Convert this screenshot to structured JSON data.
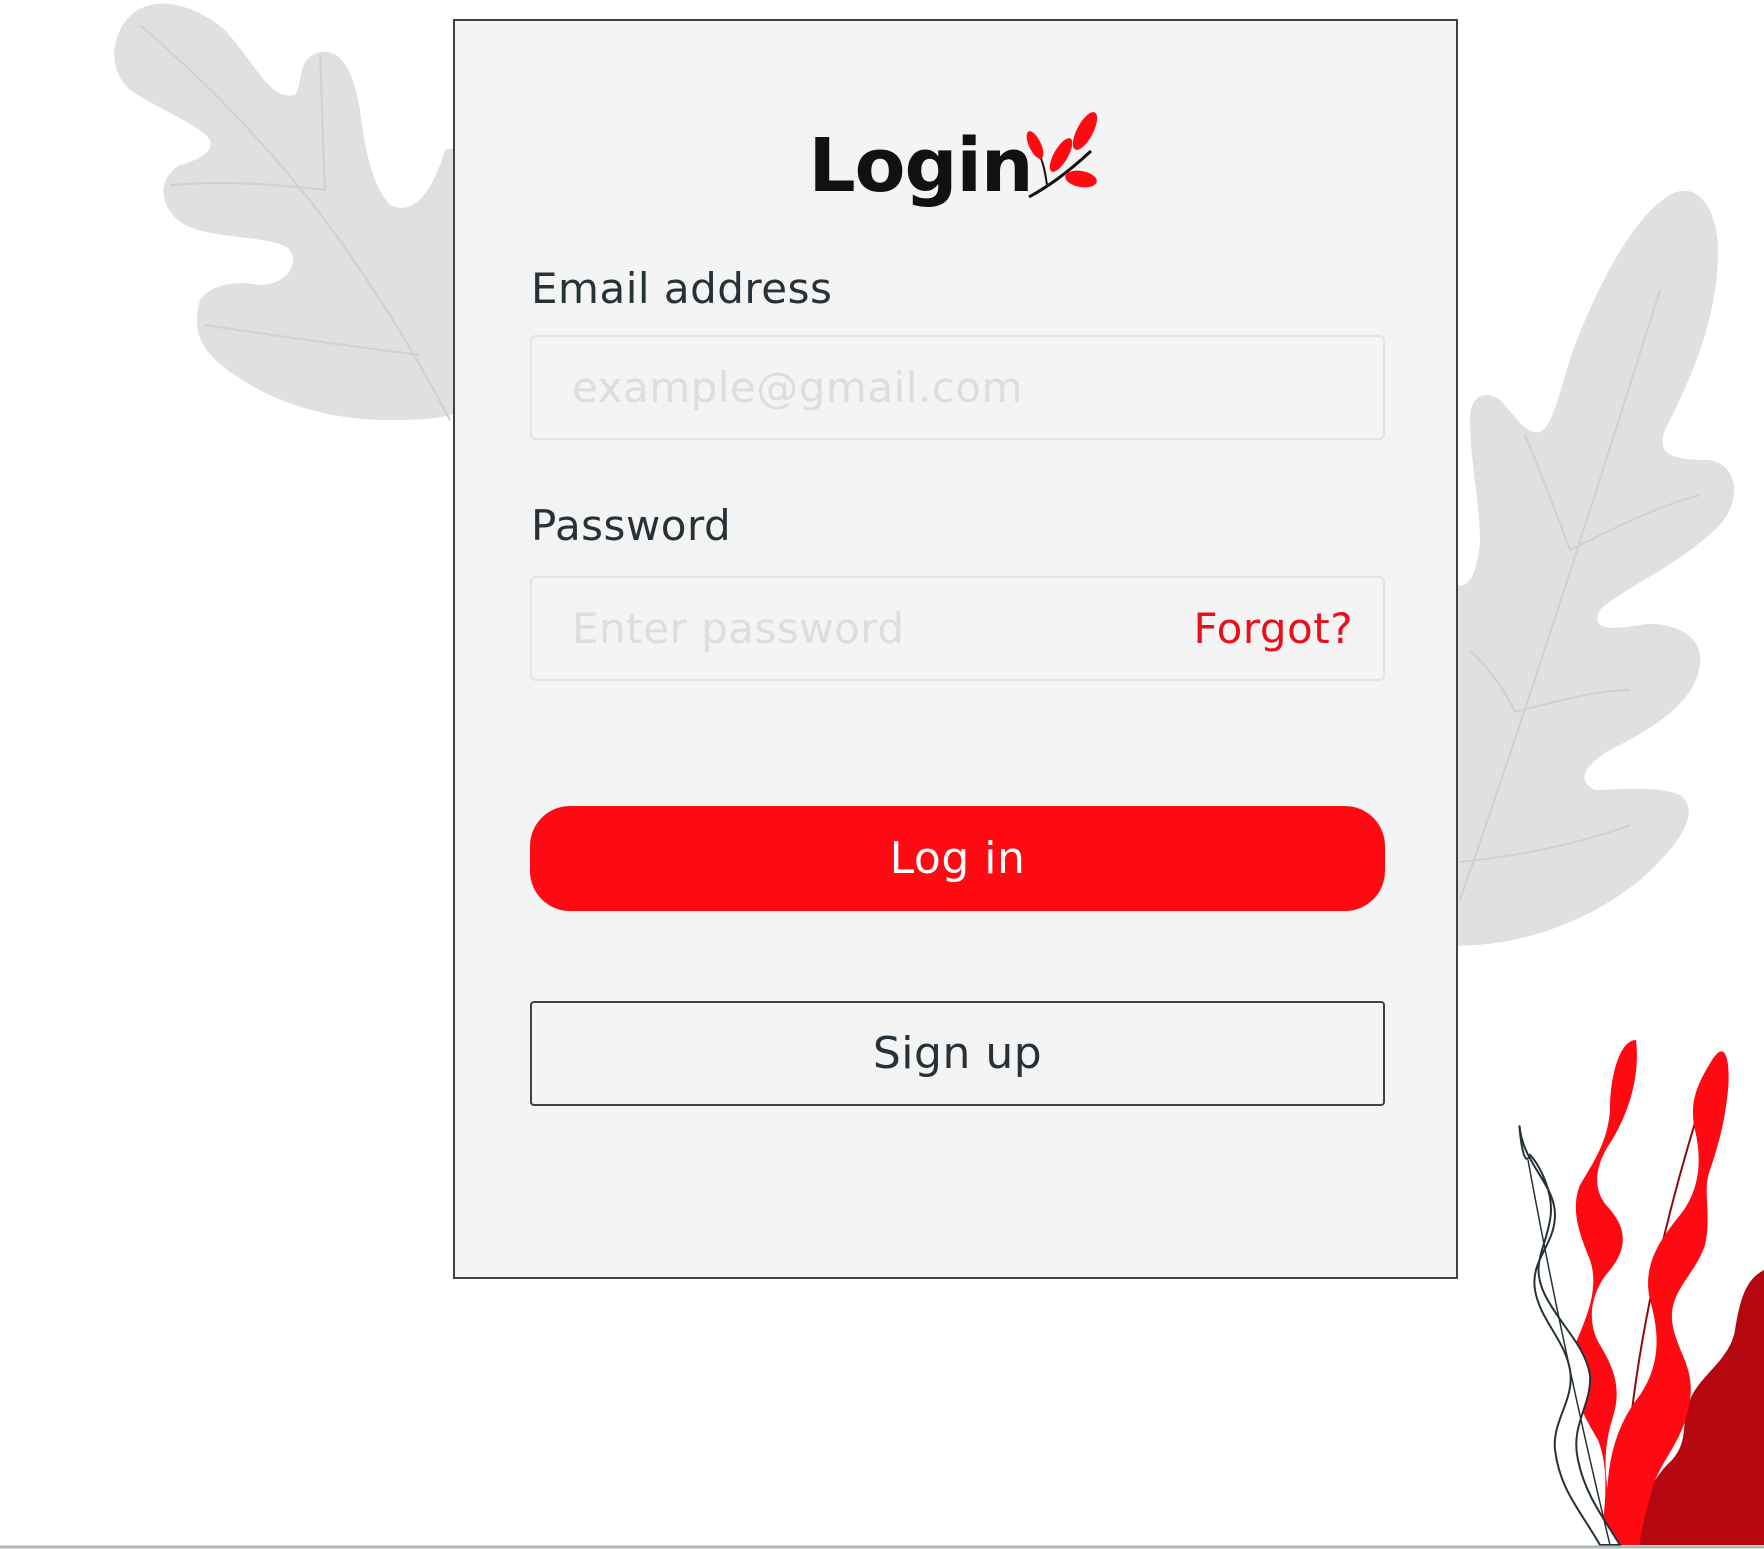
{
  "login_form": {
    "title": "Login",
    "email": {
      "label": "Email address",
      "placeholder": "example@gmail.com"
    },
    "password": {
      "label": "Password",
      "placeholder": "Enter password",
      "forgot_link": "Forgot?"
    },
    "login_button": "Log in",
    "signup_button": "Sign up"
  },
  "icons": {
    "title_sprig": "leaf-sprig-icon",
    "background_left": "oak-leaf-illustration",
    "background_right": "oak-leaf-illustration",
    "plant": "red-plant-illustration"
  },
  "colors": {
    "accent": "#ff0a12",
    "card_background": "#f4f4f4",
    "card_border": "#38444a",
    "text": "#263238",
    "placeholder": "#dddddd",
    "background_leaves": "#e0e0e0"
  }
}
